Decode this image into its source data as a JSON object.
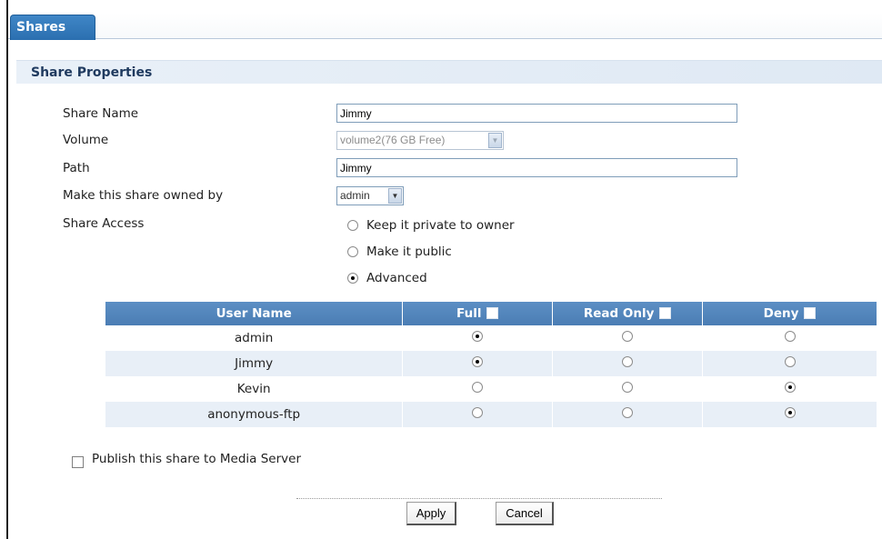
{
  "tabs": [
    {
      "label": "Shares",
      "active": true
    }
  ],
  "section": {
    "title": "Share Properties"
  },
  "form": {
    "share_name": {
      "label": "Share Name",
      "value": "Jimmy"
    },
    "volume": {
      "label": "Volume",
      "value": "volume2(76 GB Free)"
    },
    "path": {
      "label": "Path",
      "value": "Jimmy"
    },
    "owner": {
      "label": "Make this share owned by",
      "value": "admin"
    },
    "share_access": {
      "label": "Share Access",
      "options": [
        {
          "label": "Keep it private to owner",
          "selected": false
        },
        {
          "label": "Make it public",
          "selected": false
        },
        {
          "label": "Advanced",
          "selected": true
        }
      ]
    }
  },
  "acl_table": {
    "headers": [
      "User Name",
      "Full",
      "Read Only",
      "Deny"
    ],
    "rows": [
      {
        "user": "admin",
        "access": "Full"
      },
      {
        "user": "Jimmy",
        "access": "Full"
      },
      {
        "user": "Kevin",
        "access": "Deny"
      },
      {
        "user": "anonymous-ftp",
        "access": "Deny"
      }
    ]
  },
  "publish": {
    "label": "Publish this share to Media Server",
    "checked": false
  },
  "buttons": {
    "apply": "Apply",
    "cancel": "Cancel"
  },
  "colors": {
    "tab": "#2f74b5",
    "table_header": "#5585bb",
    "row_alt": "#e8eff7",
    "section_bg": "#e4edf6"
  }
}
